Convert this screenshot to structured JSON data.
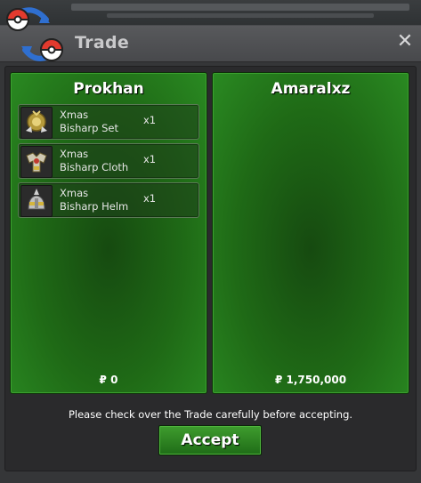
{
  "window": {
    "title": "Trade",
    "close_glyph": "✕",
    "logo_icon": "pokeball-exchange-icon"
  },
  "left_panel": {
    "player_name": "Prokhan",
    "items": [
      {
        "line1": "Xmas",
        "line2": "Bisharp Set",
        "qty": "x1",
        "icon": "bisharp-set-icon"
      },
      {
        "line1": "Xmas",
        "line2": "Bisharp Cloth",
        "qty": "x1",
        "icon": "bisharp-cloth-icon"
      },
      {
        "line1": "Xmas",
        "line2": "Bisharp Helm",
        "qty": "x1",
        "icon": "bisharp-helm-icon"
      }
    ],
    "money": "₽ 0"
  },
  "right_panel": {
    "player_name": "Amaralxz",
    "items": [],
    "money": "₽ 1,750,000"
  },
  "notice": "Please check over the Trade carefully before accepting.",
  "accept_label": "Accept",
  "colors": {
    "panel_green": "#1f6a16",
    "accept_green": "#2e8a22",
    "window_bg": "#353638"
  }
}
